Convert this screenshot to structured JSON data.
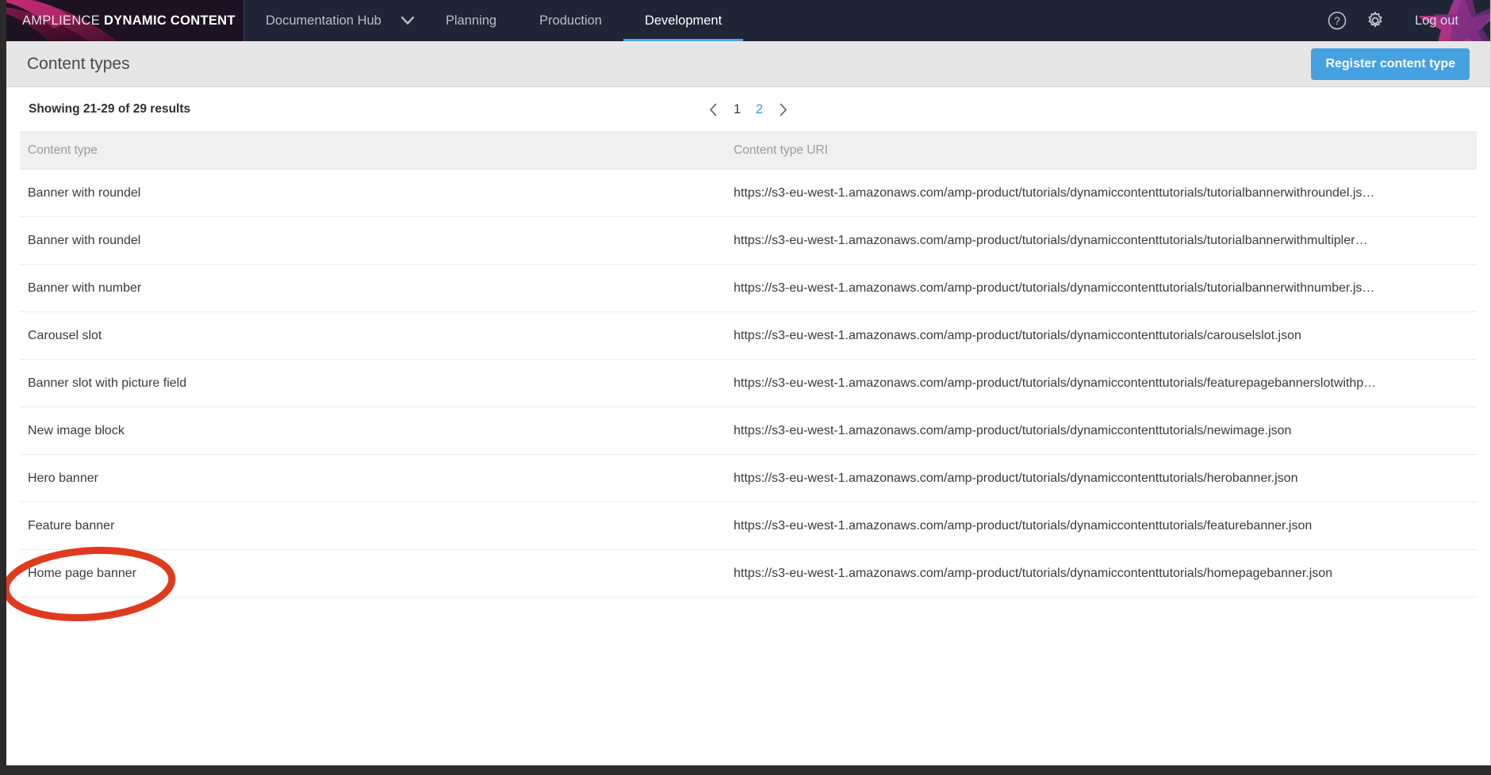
{
  "brand": {
    "word_light": "AMPLIENCE",
    "word_bold": "DYNAMIC CONTENT"
  },
  "nav": {
    "items": [
      {
        "label": "Documentation Hub",
        "active": false,
        "has_caret": true
      },
      {
        "label": "Planning",
        "active": false,
        "has_caret": false
      },
      {
        "label": "Production",
        "active": false,
        "has_caret": false
      },
      {
        "label": "Development",
        "active": true,
        "has_caret": false
      }
    ],
    "caret_icon": "chevron-down-icon",
    "help_icon": "help-circle-icon",
    "settings_icon": "gear-icon",
    "logout_label": "Log out",
    "active_underline_color": "#4aa7e0"
  },
  "page": {
    "title": "Content types",
    "register_button": "Register content type",
    "register_button_color": "#45a1e0"
  },
  "results": {
    "showing": "Showing 21-29 of 29 results"
  },
  "pagination": {
    "prev_icon": "chevron-left-icon",
    "next_icon": "chevron-right-icon",
    "pages": [
      "1",
      "2"
    ],
    "current": "2",
    "active_color": "#3d97d8"
  },
  "table": {
    "columns": [
      "Content type",
      "Content type URI"
    ],
    "rows": [
      {
        "name": "Banner with roundel",
        "uri": "https://s3-eu-west-1.amazonaws.com/amp-product/tutorials/dynamiccontenttutorials/tutorialbannerwithroundel.js…"
      },
      {
        "name": "Banner with roundel",
        "uri": "https://s3-eu-west-1.amazonaws.com/amp-product/tutorials/dynamiccontenttutorials/tutorialbannerwithmultipler…"
      },
      {
        "name": "Banner with number",
        "uri": "https://s3-eu-west-1.amazonaws.com/amp-product/tutorials/dynamiccontenttutorials/tutorialbannerwithnumber.js…"
      },
      {
        "name": "Carousel slot",
        "uri": "https://s3-eu-west-1.amazonaws.com/amp-product/tutorials/dynamiccontenttutorials/carouselslot.json"
      },
      {
        "name": "Banner slot with picture field",
        "uri": "https://s3-eu-west-1.amazonaws.com/amp-product/tutorials/dynamiccontenttutorials/featurepagebannerslotwithp…"
      },
      {
        "name": "New image block",
        "uri": "https://s3-eu-west-1.amazonaws.com/amp-product/tutorials/dynamiccontenttutorials/newimage.json"
      },
      {
        "name": "Hero banner",
        "uri": "https://s3-eu-west-1.amazonaws.com/amp-product/tutorials/dynamiccontenttutorials/herobanner.json"
      },
      {
        "name": "Feature banner",
        "uri": "https://s3-eu-west-1.amazonaws.com/amp-product/tutorials/dynamiccontenttutorials/featurebanner.json"
      },
      {
        "name": "Home page banner",
        "uri": "https://s3-eu-west-1.amazonaws.com/amp-product/tutorials/dynamiccontenttutorials/homepagebanner.json"
      }
    ]
  },
  "annotation": {
    "shape": "ellipse-highlight",
    "target": "Home page banner",
    "color": "#e03a1e"
  }
}
